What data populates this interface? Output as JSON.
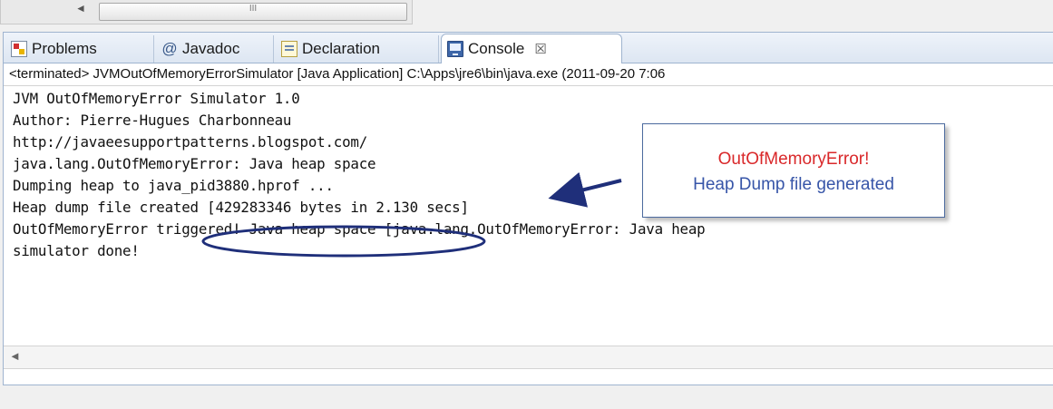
{
  "top_scrollbar": {
    "thumb_grip": "III"
  },
  "tabs": [
    {
      "label": "Problems",
      "icon": "problems-icon"
    },
    {
      "label": "Javadoc",
      "icon": "at-icon"
    },
    {
      "label": "Declaration",
      "icon": "declaration-icon"
    },
    {
      "label": "Console",
      "icon": "console-icon",
      "active": true
    }
  ],
  "close_glyph": "☒",
  "status_line": "<terminated> JVMOutOfMemoryErrorSimulator [Java Application] C:\\Apps\\jre6\\bin\\java.exe (2011-09-20 7:06",
  "console_lines": [
    "JVM OutOfMemoryError Simulator 1.0",
    "Author: Pierre-Hugues Charbonneau",
    "http://javaeesupportpatterns.blogspot.com/",
    "java.lang.OutOfMemoryError: Java heap space",
    "Dumping heap to java_pid3880.hprof ...",
    "Heap dump file created [429283346 bytes in 2.130 secs]",
    "OutOfMemoryError triggered! Java heap space [java.lang.OutOfMemoryError: Java heap",
    "simulator done!"
  ],
  "callout": {
    "line1": "OutOfMemoryError!",
    "line2": "Heap Dump file generated",
    "line1_color": "#d9282a",
    "line2_color": "#3755a8"
  },
  "bottom_scrollbar": {
    "arrow": "◄"
  }
}
